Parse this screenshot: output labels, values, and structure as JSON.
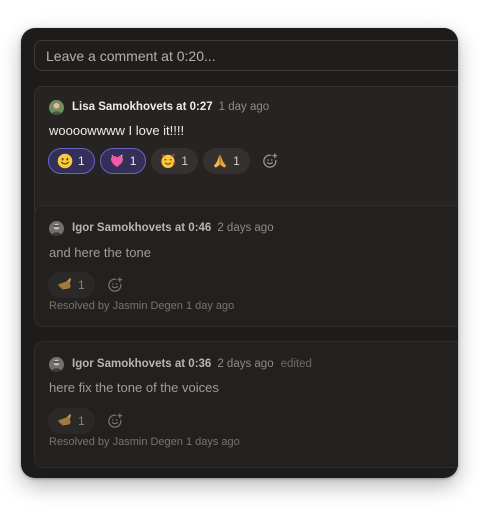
{
  "comment_box": {
    "placeholder": "Leave a comment at 0:20..."
  },
  "comments": [
    {
      "author_line": "Lisa Samokhovets at 0:27",
      "time": "1 day ago",
      "text": "woooowwww I love it!!!!",
      "reactions": [
        {
          "emoji": "smiling-face-icon",
          "count": "1",
          "active": true
        },
        {
          "emoji": "sparkling-heart-icon",
          "count": "1",
          "active": true
        },
        {
          "emoji": "smiling-face-with-hearts-icon",
          "count": "1",
          "active": false
        },
        {
          "emoji": "folded-hands-icon",
          "count": "1",
          "active": false
        }
      ]
    },
    {
      "author_line": "Igor Samokhovets at 0:46",
      "time": "2 days ago",
      "text": "and here the tone",
      "reactions": [
        {
          "emoji": "pinched-hand-icon",
          "count": "1",
          "active": false
        }
      ],
      "resolved_by": "Resolved by Jasmin Degen 1 day ago"
    },
    {
      "author_line": "Igor Samokhovets at 0:36",
      "time": "2 days ago",
      "edited": "edited",
      "text": "here fix the tone of the voices",
      "reactions": [
        {
          "emoji": "pinched-hand-icon",
          "count": "1",
          "active": false
        }
      ],
      "resolved_by": "Resolved by Jasmin Degen 1 days ago"
    }
  ],
  "colors": {
    "panel_bg": "#1e1c1b",
    "card_bg": "#232120",
    "active_reaction_bg": "#332f58",
    "active_reaction_border": "#6a62c8",
    "text_primary": "#ecebe8",
    "text_muted": "#8f8b87"
  }
}
